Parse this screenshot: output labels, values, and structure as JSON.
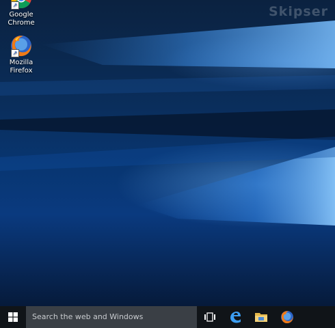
{
  "watermark": "Skipser",
  "desktop_icons": [
    {
      "label_line1": "Google",
      "label_line2": "Chrome",
      "icon": "google-chrome-icon"
    },
    {
      "label_line1": "Mozilla",
      "label_line2": "Firefox",
      "icon": "mozilla-firefox-icon"
    }
  ],
  "taskbar": {
    "start_icon": "windows-logo-icon",
    "search_placeholder": "Search the web and Windows",
    "task_view_icon": "task-view-icon",
    "pinned": [
      {
        "name": "Microsoft Edge",
        "icon": "edge-icon"
      },
      {
        "name": "File Explorer",
        "icon": "file-explorer-icon"
      },
      {
        "name": "Mozilla Firefox",
        "icon": "firefox-taskbar-icon"
      }
    ]
  },
  "colors": {
    "taskbar": "#101418",
    "search_box": "#3a3f45",
    "wallpaper_blue": "#0a3a7f"
  }
}
